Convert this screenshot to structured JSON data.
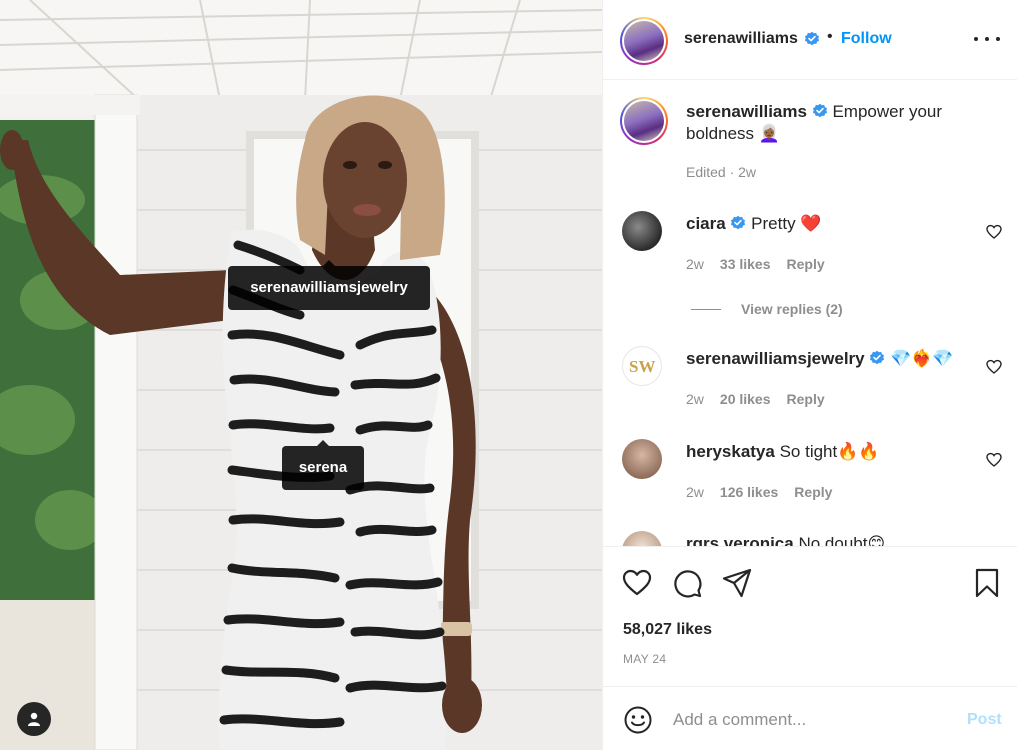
{
  "post": {
    "tags": [
      {
        "label": "serenawilliamsjewelry"
      },
      {
        "label": "serena"
      }
    ]
  },
  "header": {
    "username": "serenawilliams",
    "separator": "•",
    "follow_label": "Follow",
    "verified_color": "#3897f0"
  },
  "caption": {
    "username": "serenawilliams",
    "text": "Empower your boldness 👩🏾‍🦳",
    "meta": "Edited · 2w"
  },
  "comments": [
    {
      "username": "ciara",
      "verified": true,
      "text": "Pretty ❤️",
      "time": "2w",
      "likes": "33 likes",
      "reply_label": "Reply"
    },
    {
      "username": "serenawilliamsjewelry",
      "verified": true,
      "text": "💎❤️‍🔥💎",
      "time": "2w",
      "likes": "20 likes",
      "reply_label": "Reply"
    },
    {
      "username": "heryskatya",
      "verified": false,
      "text": "So tight🔥🔥",
      "time": "2w",
      "likes": "126 likes",
      "reply_label": "Reply"
    },
    {
      "username": "rgrs.veronica",
      "verified": false,
      "text": "No doubt😊",
      "time": "",
      "likes": "",
      "reply_label": ""
    }
  ],
  "view_replies": "View replies (2)",
  "actions": {
    "like_icon": "heart-icon",
    "comment_icon": "comment-icon",
    "share_icon": "paper-plane-icon",
    "save_icon": "bookmark-icon"
  },
  "likes_count": "58,027 likes",
  "date": "MAY 24",
  "add_comment": {
    "placeholder": "Add a comment...",
    "post_label": "Post"
  },
  "colors": {
    "accent": "#0095f6",
    "text": "#262626",
    "muted": "#8e8e8e",
    "post_disabled": "#b2dffc",
    "heart_red": "#ed4956"
  }
}
